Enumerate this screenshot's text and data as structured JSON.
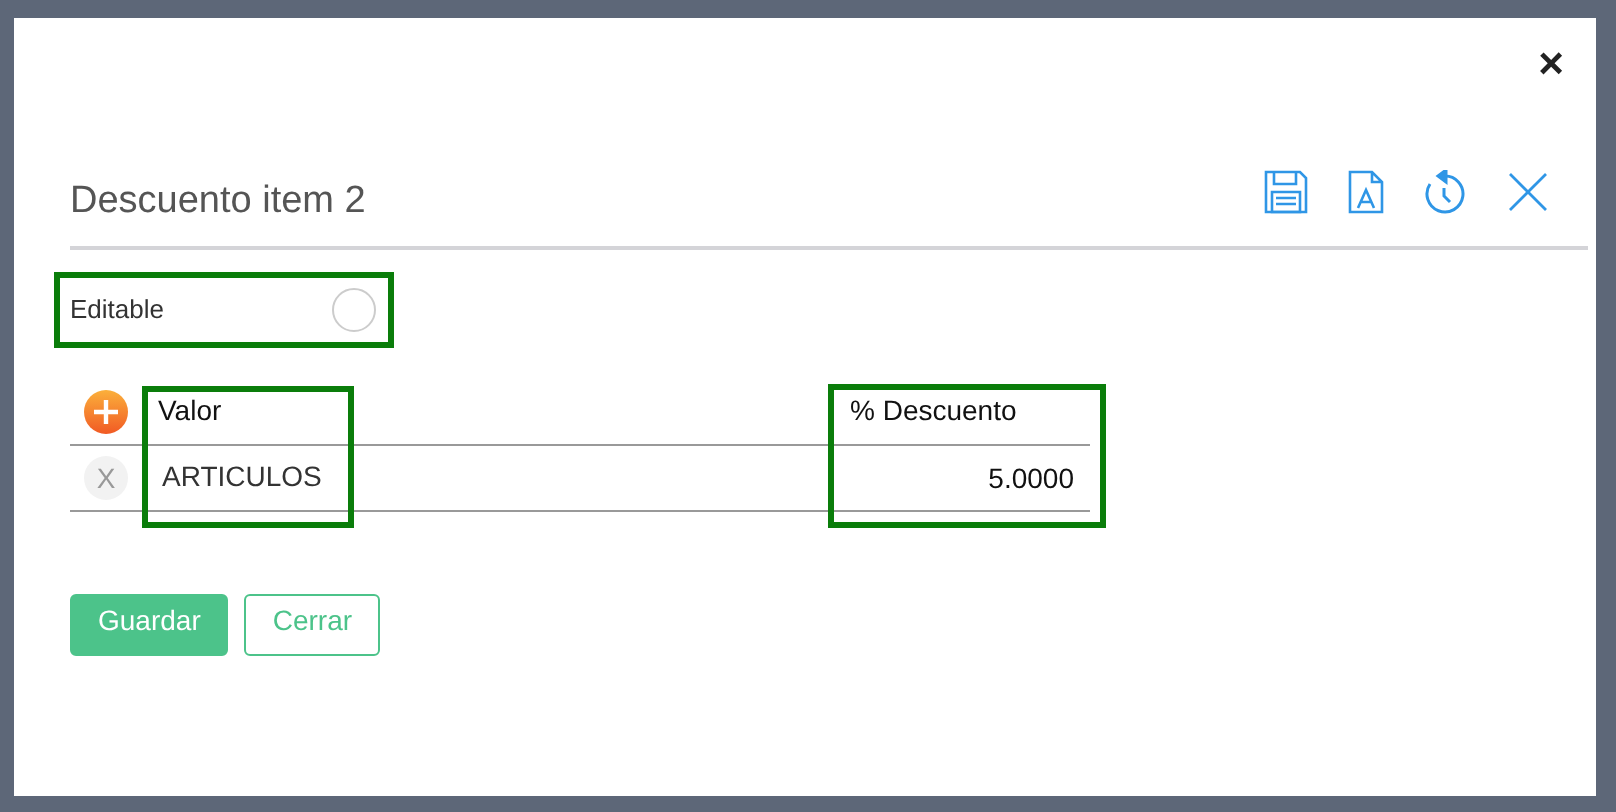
{
  "dialog": {
    "close_glyph": "×",
    "title": "Descuento item 2"
  },
  "editable": {
    "label": "Editable",
    "checked": false
  },
  "table": {
    "columns": [
      "Valor",
      "% Descuento"
    ],
    "rows": [
      {
        "delete_glyph": "X",
        "cells": [
          "ARTICULOS",
          "5.0000"
        ]
      }
    ]
  },
  "buttons": [
    {
      "label": "Guardar",
      "kind": "primary"
    },
    {
      "label": "Cerrar",
      "kind": "secondary"
    }
  ]
}
